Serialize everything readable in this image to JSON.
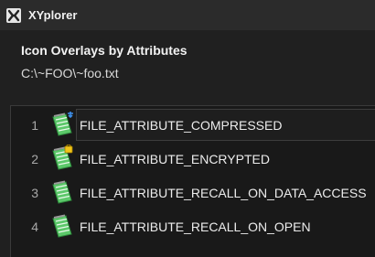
{
  "window": {
    "title": "XYplorer",
    "logo_icon": "xyplorer-logo-icon"
  },
  "header": {
    "title": "Icon Overlays by Attributes",
    "path": "C:\\~FOO\\~foo.txt"
  },
  "list": {
    "items": [
      {
        "index": "1",
        "name": "FILE_ATTRIBUTE_COMPRESSED",
        "overlay": "compressed-arrows-overlay",
        "overlay_color": "#3d8ee8"
      },
      {
        "index": "2",
        "name": "FILE_ATTRIBUTE_ENCRYPTED",
        "overlay": "lock-overlay",
        "overlay_color": "#f0c419"
      },
      {
        "index": "3",
        "name": "FILE_ATTRIBUTE_RECALL_ON_DATA_ACCESS",
        "overlay": "none",
        "overlay_color": ""
      },
      {
        "index": "4",
        "name": "FILE_ATTRIBUTE_RECALL_ON_OPEN",
        "overlay": "none",
        "overlay_color": ""
      }
    ]
  },
  "colors": {
    "background": "#202020",
    "titlebar": "#2b2b2b",
    "notepad_green": "#5cc86a",
    "notepad_dark_green": "#2e8a3c"
  }
}
